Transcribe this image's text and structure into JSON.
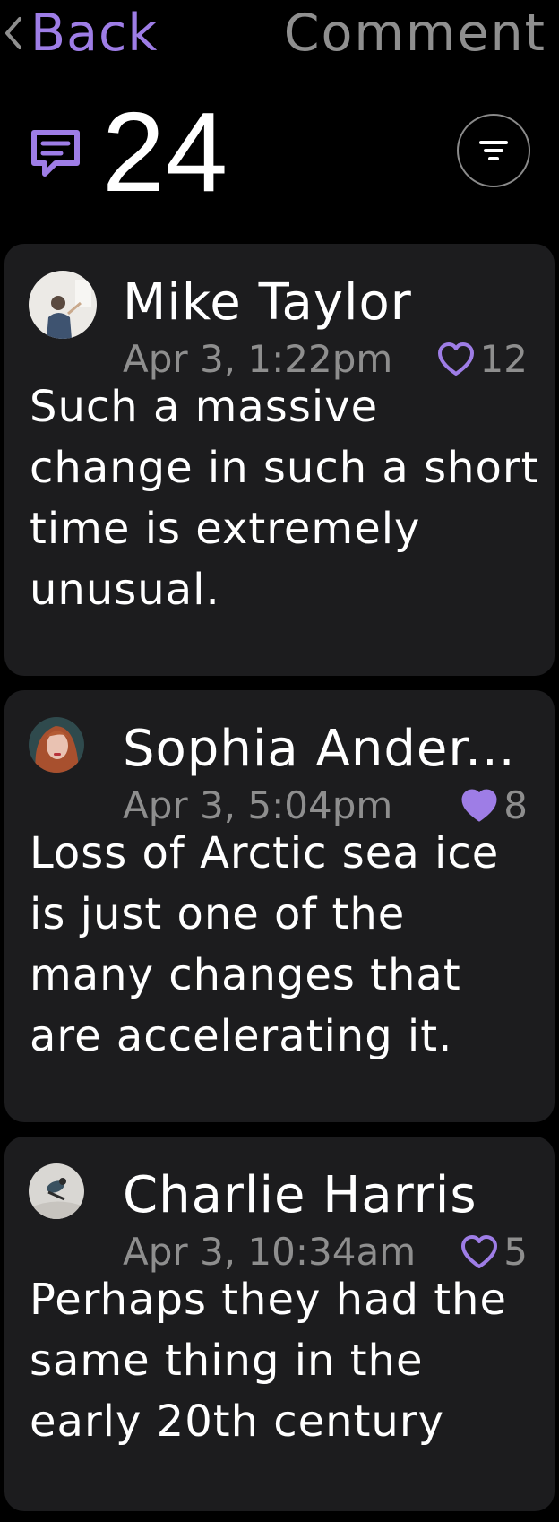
{
  "nav": {
    "back_label": "Back",
    "title": "Comment"
  },
  "summary": {
    "count": "24",
    "comment_icon": "comment-icon",
    "filter_icon": "filter-icon"
  },
  "colors": {
    "accent": "#9e7de6",
    "card_bg": "#1c1c1e",
    "muted_text": "#8e8e8e",
    "background": "#000000"
  },
  "comments": [
    {
      "author": "Mike Taylor",
      "time": "Apr 3, 1:22pm",
      "likes": "12",
      "liked": false,
      "text": "Such a massive change in such a short time is extremely unusual."
    },
    {
      "author": "Sophia Ander...",
      "time": "Apr 3, 5:04pm",
      "likes": "8",
      "liked": true,
      "text": "Loss of Arctic sea ice is just one of the many changes that are accelerating it."
    },
    {
      "author": "Charlie Harris",
      "time": "Apr 3, 10:34am",
      "likes": "5",
      "liked": false,
      "text": "Perhaps they had the same thing in the early 20th century"
    }
  ]
}
